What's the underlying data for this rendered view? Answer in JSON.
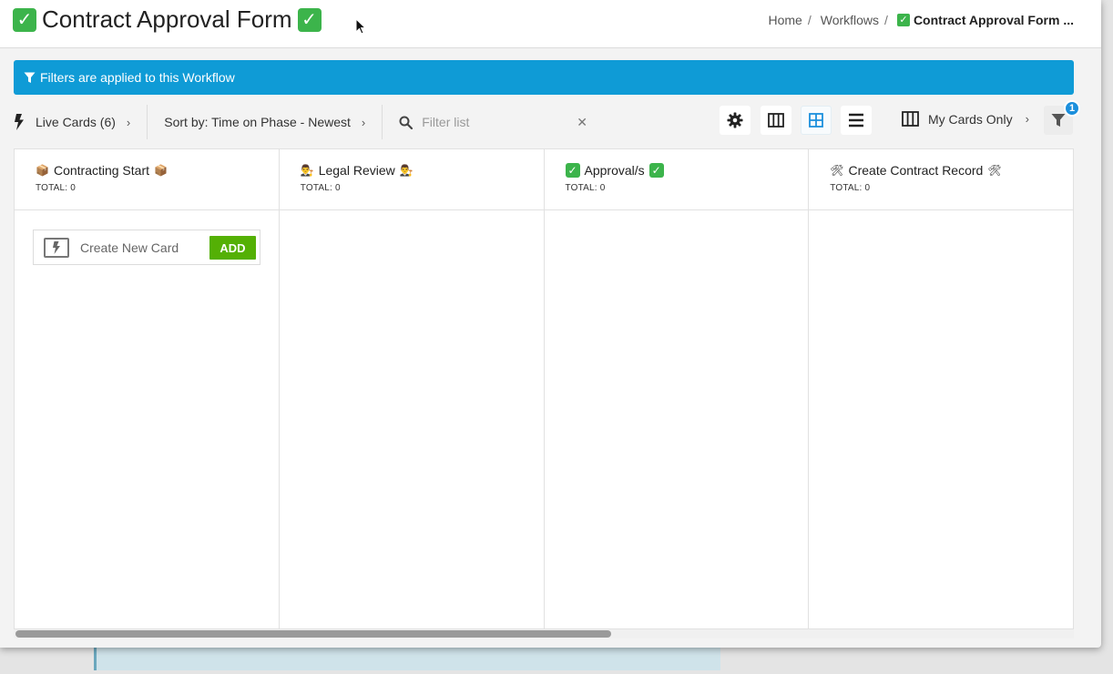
{
  "header": {
    "title": "Contract Approval Form",
    "title_emoji": "✓",
    "breadcrumb": {
      "home": "Home",
      "workflows": "Workflows",
      "current": "Contract Approval Form ...",
      "separator": "/"
    }
  },
  "banner": {
    "text": "Filters are applied to this Workflow",
    "color": "#0f9bd6"
  },
  "toolbar": {
    "live_cards": "Live Cards (6)",
    "sort": "Sort by: Time on Phase - Newest",
    "search_placeholder": "Filter list",
    "my_cards": "My Cards Only",
    "filter_badge": "1",
    "view_mode_active": "grid"
  },
  "columns": [
    {
      "title": "Contracting Start",
      "emoji": "box",
      "total": "TOTAL: 0"
    },
    {
      "title": "Legal Review",
      "emoji": "judge",
      "total": "TOTAL: 0"
    },
    {
      "title": "Approval/s",
      "emoji": "check",
      "total": "TOTAL: 0"
    },
    {
      "title": "Create Contract Record",
      "emoji": "tools",
      "total": "TOTAL: 0"
    }
  ],
  "new_card": {
    "label": "Create New Card",
    "add_label": "ADD",
    "add_color": "#54b005"
  }
}
